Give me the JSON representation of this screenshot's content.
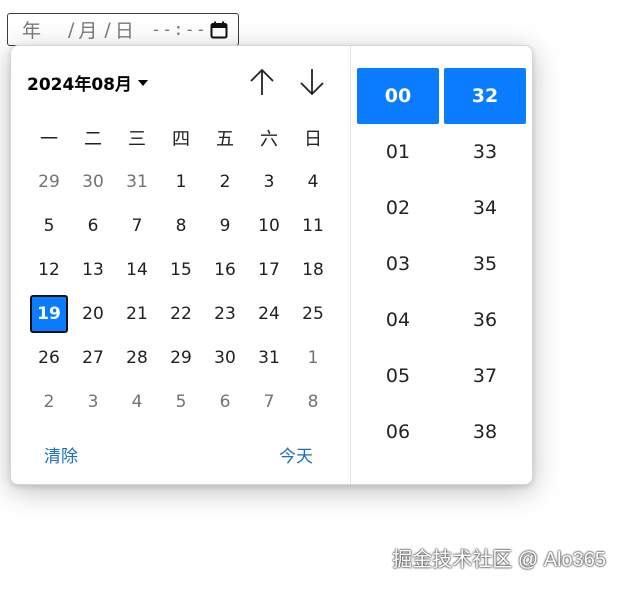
{
  "input": {
    "year_placeholder": "年",
    "sep": "/",
    "month_placeholder": "月",
    "day_placeholder": "日",
    "time_placeholder": "--:--"
  },
  "popup": {
    "month_label": "2024年08月",
    "weekdays": [
      "一",
      "二",
      "三",
      "四",
      "五",
      "六",
      "日"
    ],
    "weeks": [
      [
        "29",
        "30",
        "31",
        "1",
        "2",
        "3",
        "4"
      ],
      [
        "5",
        "6",
        "7",
        "8",
        "9",
        "10",
        "11"
      ],
      [
        "12",
        "13",
        "14",
        "15",
        "16",
        "17",
        "18"
      ],
      [
        "19",
        "20",
        "21",
        "22",
        "23",
        "24",
        "25"
      ],
      [
        "26",
        "27",
        "28",
        "29",
        "30",
        "31",
        "1"
      ],
      [
        "2",
        "3",
        "4",
        "5",
        "6",
        "7",
        "8"
      ]
    ],
    "selected_day": "19",
    "clear_label": "清除",
    "today_label": "今天",
    "hours": [
      "00",
      "01",
      "02",
      "03",
      "04",
      "05",
      "06"
    ],
    "minutes": [
      "32",
      "33",
      "34",
      "35",
      "36",
      "37",
      "38"
    ],
    "selected_hour": "00",
    "selected_minute": "32"
  },
  "watermark": "掘金技术社区 @ Alo365",
  "colors": {
    "accent": "#0a7cff",
    "link": "#1a6ec2",
    "muted_day": "#737373"
  }
}
